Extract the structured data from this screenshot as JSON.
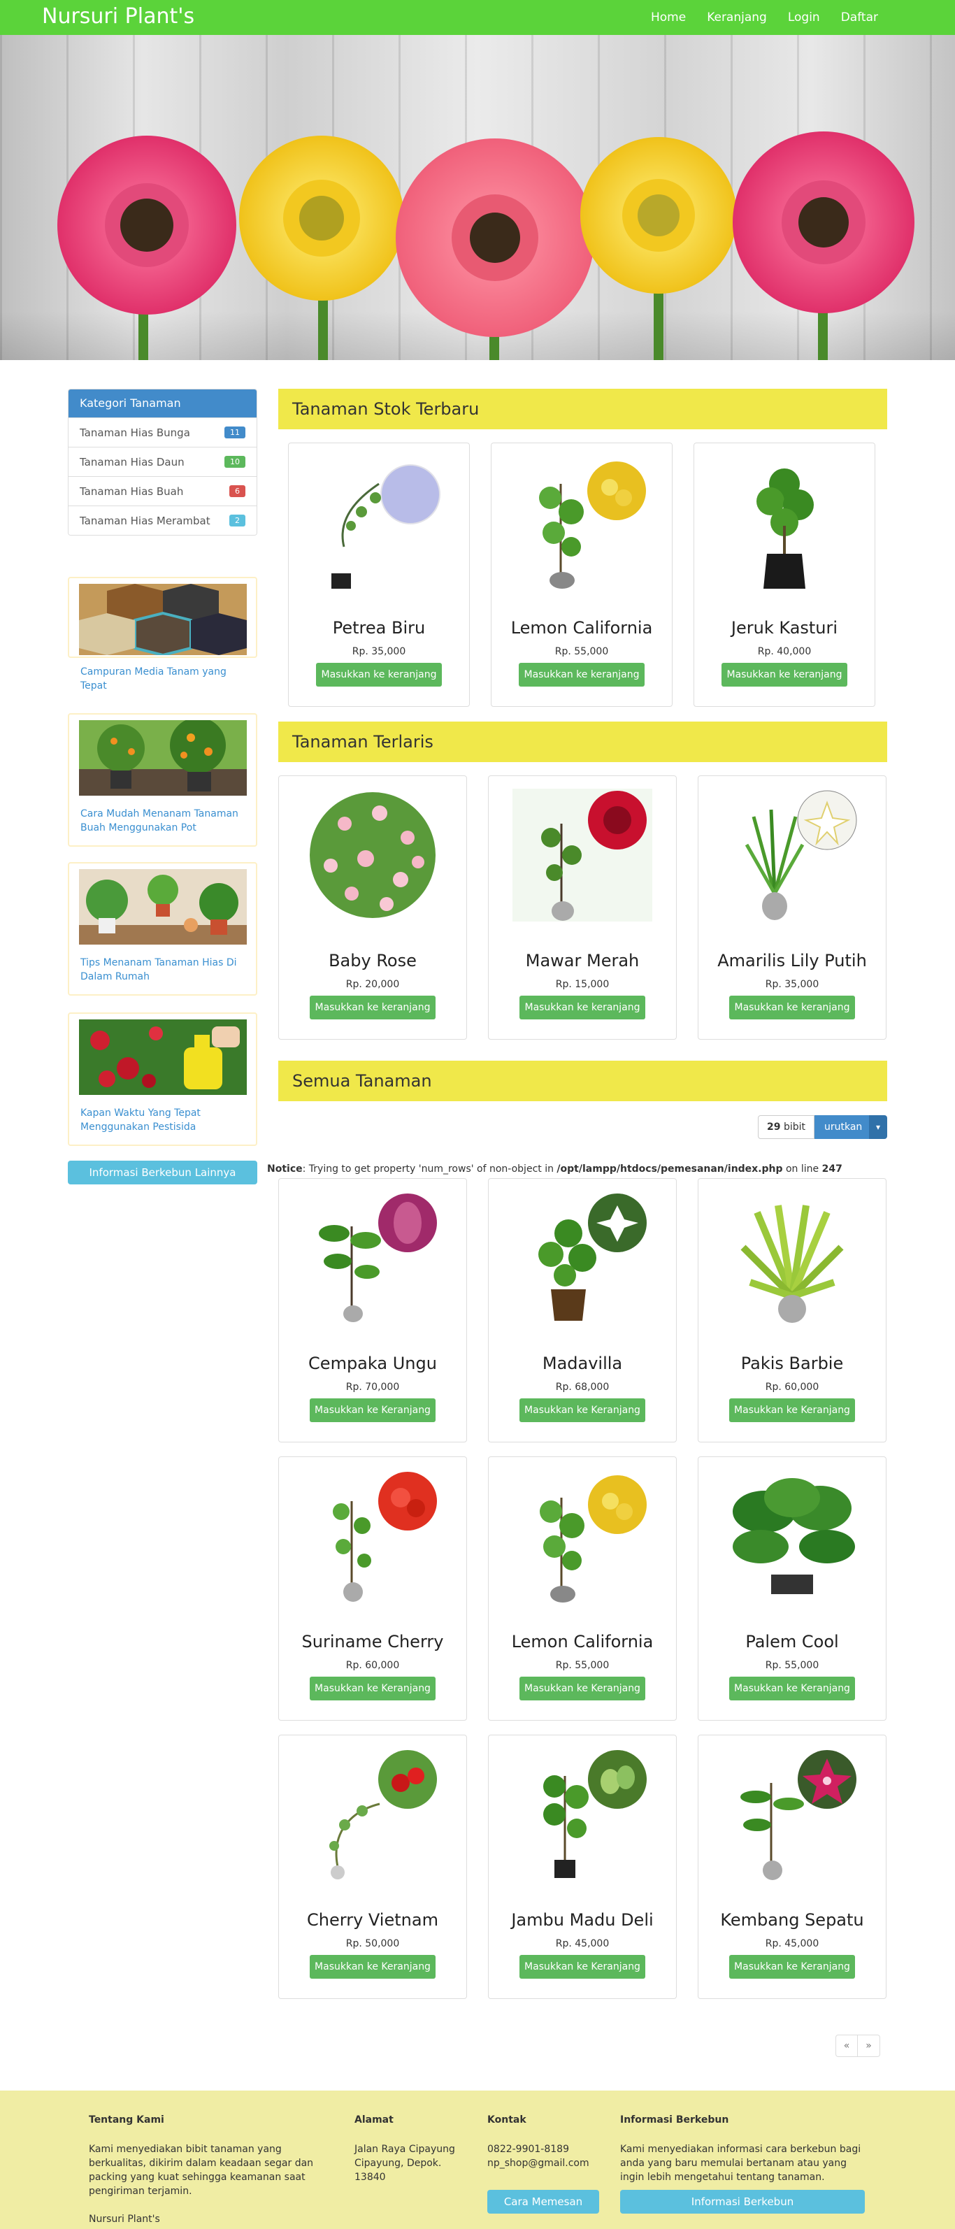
{
  "navbar": {
    "brand": "Nursuri Plant's",
    "links": [
      "Home",
      "Keranjang",
      "Login",
      "Daftar"
    ]
  },
  "sidebar": {
    "category_header": "Kategori Tanaman",
    "categories": [
      {
        "label": "Tanaman Hias Bunga",
        "count": "11",
        "color": "#428bca"
      },
      {
        "label": "Tanaman Hias Daun",
        "count": "10",
        "color": "#5cb85c"
      },
      {
        "label": "Tanaman Hias Buah",
        "count": "6",
        "color": "#d9534f"
      },
      {
        "label": "Tanaman Hias Merambat",
        "count": "2",
        "color": "#5bc0de"
      }
    ],
    "articles": [
      {
        "title": "Campuran Media Tanam yang Tepat"
      },
      {
        "title": "Cara Mudah Menanam Tanaman Buah Menggunakan Pot"
      },
      {
        "title": "Tips Menanam Tanaman Hias Di Dalam Rumah"
      },
      {
        "title": "Kapan Waktu Yang Tepat Menggunakan Pestisida"
      }
    ],
    "more_button": "Informasi Berkebun Lainnya"
  },
  "sections": {
    "latest": "Tanaman Stok Terbaru",
    "bestseller": "Tanaman Terlaris",
    "all": "Semua Tanaman"
  },
  "latest_products": [
    {
      "name": "Petrea Biru",
      "price": "Rp. 35,000",
      "button": "Masukkan ke keranjang",
      "accent": "#8a8fd4"
    },
    {
      "name": "Lemon California",
      "price": "Rp. 55,000",
      "button": "Masukkan ke keranjang",
      "accent": "#e8c020"
    },
    {
      "name": "Jeruk Kasturi",
      "price": "Rp. 40,000",
      "button": "Masukkan ke keranjang",
      "accent": ""
    }
  ],
  "bestseller_products": [
    {
      "name": "Baby Rose",
      "price": "Rp. 20,000",
      "button": "Masukkan ke keranjang",
      "accent": ""
    },
    {
      "name": "Mawar Merah",
      "price": "Rp. 15,000",
      "button": "Masukkan ke keranjang",
      "accent": "#c8102e"
    },
    {
      "name": "Amarilis Lily Putih",
      "price": "Rp. 35,000",
      "button": "Masukkan ke keranjang",
      "accent": "#f4f4f0"
    }
  ],
  "sort": {
    "count": "29",
    "unit": "bibit",
    "label": "urutkan"
  },
  "notice": {
    "label": "Notice",
    "message": ": Trying to get property 'num_rows' of non-object in ",
    "path": "/opt/lampp/htdocs/pemesanan/index.php",
    "line_text": " on line ",
    "line": "247"
  },
  "all_products": [
    {
      "name": "Cempaka Ungu",
      "price": "Rp. 70,000",
      "button": "Masukkan ke Keranjang",
      "accent": "#a02a6a"
    },
    {
      "name": "Madavilla",
      "price": "Rp. 68,000",
      "button": "Masukkan ke Keranjang",
      "accent": "#ffffff"
    },
    {
      "name": "Pakis Barbie",
      "price": "Rp. 60,000",
      "button": "Masukkan ke Keranjang",
      "accent": ""
    },
    {
      "name": "Suriname Cherry",
      "price": "Rp. 60,000",
      "button": "Masukkan ke Keranjang",
      "accent": "#e03020"
    },
    {
      "name": "Lemon California",
      "price": "Rp. 55,000",
      "button": "Masukkan ke Keranjang",
      "accent": "#e8c020"
    },
    {
      "name": "Palem Cool",
      "price": "Rp. 55,000",
      "button": "Masukkan ke Keranjang",
      "accent": ""
    },
    {
      "name": "Cherry Vietnam",
      "price": "Rp. 50,000",
      "button": "Masukkan ke Keranjang",
      "accent": "#c81818"
    },
    {
      "name": "Jambu Madu Deli",
      "price": "Rp. 45,000",
      "button": "Masukkan ke Keranjang",
      "accent": "#8cc060"
    },
    {
      "name": "Kembang Sepatu",
      "price": "Rp. 45,000",
      "button": "Masukkan ke Keranjang",
      "accent": "#d02060"
    }
  ],
  "pager": {
    "prev": "«",
    "next": "»"
  },
  "footer": {
    "about": {
      "title": "Tentang Kami",
      "text": "Kami menyediakan bibit tanaman yang berkualitas, dikirim dalam keadaan segar dan packing yang kuat sehingga keamanan saat pengiriman terjamin.",
      "sign": "Nursuri Plant's"
    },
    "address": {
      "title": "Alamat",
      "text": "Jalan Raya Cipayung Cipayung, Depok. 13840"
    },
    "contact": {
      "title": "Kontak",
      "phone": "0822-9901-8189",
      "email": "np_shop@gmail.com",
      "button": "Cara Memesan"
    },
    "info": {
      "title": "Informasi Berkebun",
      "text": "Kami menyediakan informasi cara berkebun bagi anda yang baru memulai bertanam atau yang ingin lebih mengetahui tentang tanaman.",
      "button": "Informasi Berkebun"
    }
  },
  "colors": {
    "navbar": "#5bd33a",
    "section_header": "#f0e84a",
    "button_green": "#5cb85c",
    "button_blue": "#5bc0de",
    "footer": "#f0eda4"
  }
}
